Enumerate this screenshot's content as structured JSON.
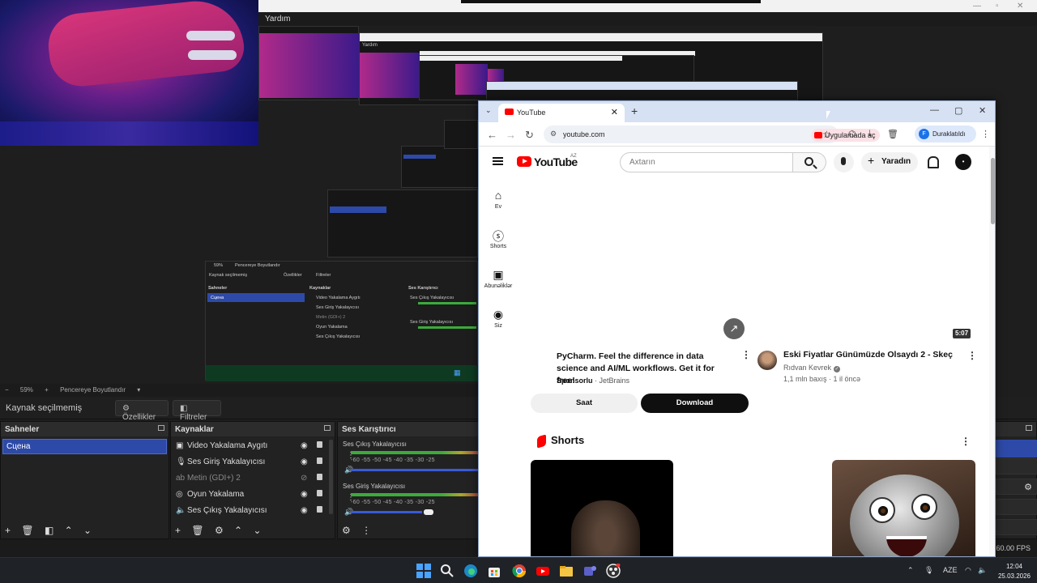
{
  "obs": {
    "menu_help": "Yardım",
    "zoom_label": "59%",
    "resize_label": "Pencereye Boyutlandır",
    "no_source_selected": "Kaynak seçilmemiş",
    "properties_btn": "Özellikler",
    "filters_btn": "Filtreler",
    "scenes": {
      "title": "Sahneler",
      "items": [
        "Сцена"
      ]
    },
    "sources": {
      "title": "Kaynaklar",
      "items": [
        {
          "label": "Video Yakalama Aygıtı",
          "icon": "camera-icon",
          "hidden": false
        },
        {
          "label": "Ses Giriş Yakalayıcısı",
          "icon": "mic-icon",
          "hidden": false
        },
        {
          "label": "Metin (GDI+) 2",
          "icon": "text-icon",
          "hidden": true
        },
        {
          "label": "Oyun Yakalama",
          "icon": "gamepad-icon",
          "hidden": false
        },
        {
          "label": "Ses Çıkış Yakalayıcısı",
          "icon": "speaker-icon",
          "hidden": false
        }
      ]
    },
    "mixer": {
      "title": "Ses Karıştırıcı",
      "channels": [
        {
          "name": "Ses Çıkış Yakalayıcısı",
          "level": 0.95
        },
        {
          "name": "Ses Giriş Yakalayıcısı",
          "level": 0.55
        }
      ],
      "ticks": "-60  -55  -50  -45  -40  -35  -30  -25"
    },
    "fps": "/ 60.00 FPS",
    "mini": {
      "no_source": "Kaynak seçilmemiş",
      "props": "Özellikler",
      "filters": "Filtreler",
      "scenes": "Sahneler",
      "sources": "Kaynaklar",
      "mixer": "Ses Karıştırıcı",
      "scene_item": "Сцена",
      "items": [
        "Video Yakalama Aygıtı",
        "Ses Giriş Yakalayıcısı",
        "Metin (GDI+) 2",
        "Oyun Yakalama",
        "Ses Çıkış Yakalayıcısı"
      ],
      "zoom": "59%",
      "resize": "Pencereye Boyutlandır",
      "mix_ch1": "Ses Çıkış Yakalayıcısı",
      "mix_ch2": "Ses Giriş Yakalayıcısı",
      "help": "Yardım"
    }
  },
  "browser": {
    "tab_title": "YouTube",
    "url": "youtube.com",
    "open_in_app": "Uygulamada aç",
    "profile_initial": "F",
    "profile_status": "Duraklatıldı"
  },
  "youtube": {
    "logo": "YouTube",
    "country": "AZ",
    "search_placeholder": "Axtarın",
    "create_label": "Yaradın",
    "guide": [
      {
        "label": "Ev",
        "icon": "home-icon"
      },
      {
        "label": "Shorts",
        "icon": "shorts-icon"
      },
      {
        "label": "Abunəliklər",
        "icon": "subscriptions-icon"
      },
      {
        "label": "Siz",
        "icon": "you-icon"
      }
    ],
    "ad": {
      "title": "PyCharm. Feel the difference in data science and AI/ML workflows. Get it for free!",
      "sponsored": "Sponsorlu",
      "advertiser": "JetBrains",
      "site_btn": "Saat",
      "download_btn": "Download"
    },
    "video": {
      "duration": "5:07",
      "title": "Eski Fiyatlar Günümüzde Olsaydı 2 - Skeç",
      "channel": "Rıdvan Kevrek",
      "meta": "1,1 mln baxış · 1 il öncə"
    },
    "shorts_title": "Shorts"
  },
  "taskbar": {
    "lang": "AZE",
    "time": "12:04",
    "date": "25.03.2026"
  },
  "colors": {
    "yt_red": "#ff0000",
    "obs_selected": "#2e4aa8",
    "chrome_frame": "#d6e1f3"
  }
}
